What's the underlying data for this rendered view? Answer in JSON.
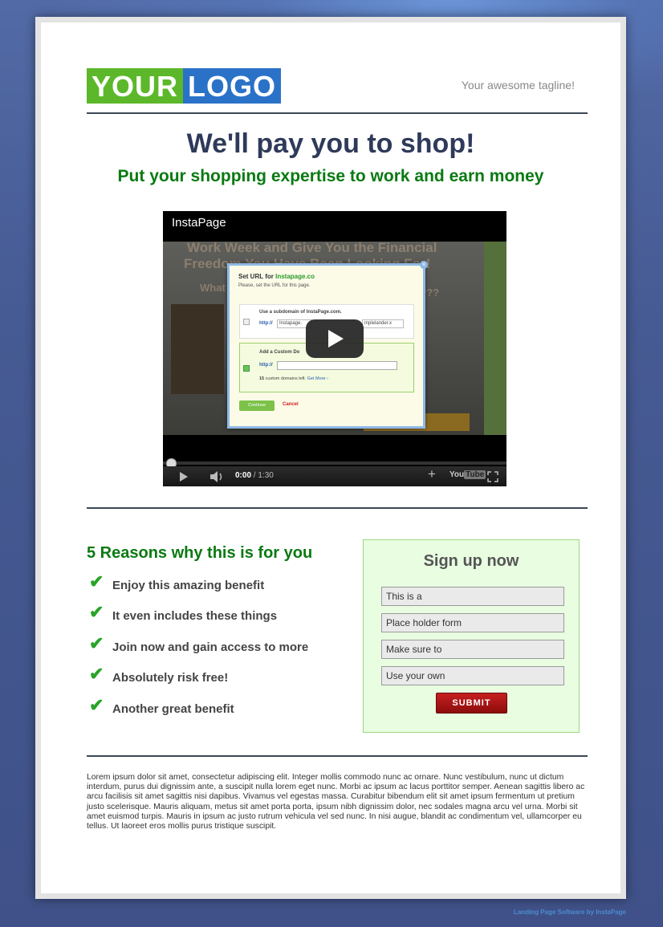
{
  "header": {
    "logo_part1": "YOUR",
    "logo_part2": "LOGO",
    "tagline": "Your awesome tagline!"
  },
  "hero": {
    "headline": "We'll pay you to shop!",
    "subheadline": "Put your shopping expertise to work and earn money"
  },
  "video": {
    "title": "InstaPage",
    "background_text_1": "Work Week and Give You the Financial",
    "background_text_2": "Freedom You Have Been Looking For!",
    "background_text_3": "What",
    "background_text_4": "er??",
    "dialog_title_prefix": "Set URL for",
    "dialog_title_domain": "Instapage.co",
    "dialog_subtitle": "Please, set the URL for this page.",
    "option1_label": "Use a subdomain of InstaPage.com.",
    "option1_prefix": "http://",
    "option1_value": "Instapage.",
    "option1_suffix": "mplelander.x",
    "option2_label": "Add a Custom Do",
    "option2_prefix": "http://",
    "option2_note_count": "15",
    "option2_note": "custom domains left.",
    "option2_link": "Get More ›",
    "continue_label": "Continue",
    "cancel_label": "Cancel",
    "time_current": "0:00",
    "time_total": "/ 1:30",
    "youtube_you": "You",
    "youtube_tube": "Tube"
  },
  "reasons": {
    "title": "5 Reasons why this is for you",
    "items": [
      "Enjoy this amazing benefit",
      "It even includes these things",
      "Join now and gain access to more",
      "Absolutely risk free!",
      "Another great benefit"
    ]
  },
  "signup": {
    "title": "Sign up now",
    "fields": [
      {
        "placeholder": "This is a"
      },
      {
        "placeholder": "Place holder form"
      },
      {
        "placeholder": "Make sure to"
      },
      {
        "placeholder": "Use your own"
      }
    ],
    "submit_label": "SUBMIT"
  },
  "body_text": "Lorem ipsum dolor sit amet, consectetur adipiscing elit. Integer mollis commodo nunc ac ornare. Nunc vestibulum, nunc ut dictum interdum, purus dui dignissim ante, a suscipit nulla lorem eget nunc. Morbi ac ipsum ac lacus porttitor semper. Aenean sagittis libero ac arcu facilisis sit amet sagittis nisi dapibus. Vivamus vel egestas massa. Curabitur bibendum elit sit amet ipsum fermentum ut pretium justo scelerisque. Mauris aliquam, metus sit amet porta porta, ipsum nibh dignissim dolor, nec sodales magna arcu vel urna. Morbi sit amet euismod turpis. Mauris in ipsum ac justo rutrum vehicula vel sed nunc. In nisi augue, blandit ac condimentum vel, ullamcorper eu tellus. Ut laoreet eros mollis purus tristique suscipit.",
  "footer": {
    "credit": "Landing Page Software by InstaPage"
  },
  "icons": {
    "check": "check-icon",
    "play": "play-icon",
    "volume": "volume-icon",
    "fullscreen": "fullscreen-icon",
    "add": "plus-icon"
  },
  "colors": {
    "logo_green": "#5cb82a",
    "logo_blue": "#2a72c7",
    "headline": "#2f3a5a",
    "accent_green": "#0a7a12",
    "submit_red": "#b01818",
    "signup_bg": "#e9fde1"
  }
}
